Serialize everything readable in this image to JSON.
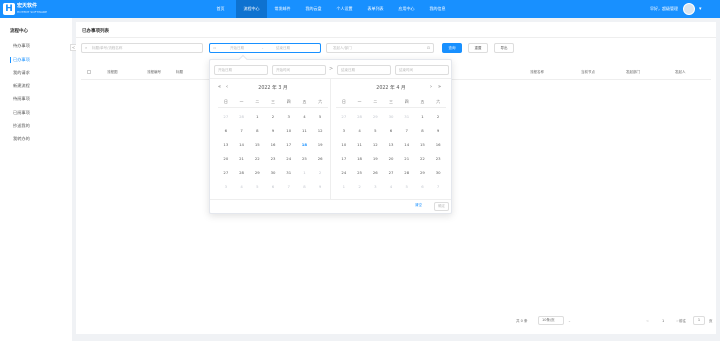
{
  "brand": {
    "name": "宏天软件",
    "sub": "HOTENT SOFTWARE",
    "logo_letter": "H"
  },
  "nav": [
    {
      "label": "首页"
    },
    {
      "label": "流程中心",
      "active": true
    },
    {
      "label": "常发邮件"
    },
    {
      "label": "我的云盘"
    },
    {
      "label": "个人设置"
    },
    {
      "label": "表单列表"
    },
    {
      "label": "应用中心"
    },
    {
      "label": "我的信息"
    }
  ],
  "user": {
    "greeting": "早好，超级管理"
  },
  "sidebar": {
    "title": "流程中心",
    "items": [
      {
        "label": "待办事项"
      },
      {
        "label": "已办事项",
        "active": true
      },
      {
        "label": "我的请求"
      },
      {
        "label": "新建流程"
      },
      {
        "label": "待阅事项"
      },
      {
        "label": "已阅事项"
      },
      {
        "label": "抄送我的"
      },
      {
        "label": "我转办的"
      }
    ],
    "collapse": "<"
  },
  "main": {
    "title": "已办事项列表",
    "search_placeholder": "标题/单号/流程名称",
    "date_start": "开始日期",
    "date_sep": "-",
    "date_end": "结束日期",
    "person_placeholder": "发起人/部门",
    "btn_search": "查询",
    "btn_reset": "重置",
    "btn_export": "导出",
    "columns": [
      "流程图",
      "流程编号",
      "标题",
      "流程名称",
      "当前节点",
      "发起部门",
      "发起人"
    ]
  },
  "picker": {
    "start_date_ph": "开始日期",
    "start_time_ph": "开始时间",
    "end_date_ph": "结束日期",
    "end_time_ph": "结束时间",
    "sep": ">",
    "weekdays": [
      "日",
      "一",
      "二",
      "三",
      "四",
      "五",
      "六"
    ],
    "left": {
      "title": "2022 年 3 月",
      "days": [
        {
          "d": "27",
          "o": true
        },
        {
          "d": "28",
          "o": true
        },
        {
          "d": "1"
        },
        {
          "d": "2"
        },
        {
          "d": "3"
        },
        {
          "d": "4"
        },
        {
          "d": "5"
        },
        {
          "d": "6"
        },
        {
          "d": "7"
        },
        {
          "d": "8"
        },
        {
          "d": "9"
        },
        {
          "d": "10"
        },
        {
          "d": "11"
        },
        {
          "d": "12"
        },
        {
          "d": "13"
        },
        {
          "d": "14"
        },
        {
          "d": "15"
        },
        {
          "d": "16"
        },
        {
          "d": "17"
        },
        {
          "d": "18",
          "t": true
        },
        {
          "d": "19"
        },
        {
          "d": "20"
        },
        {
          "d": "21"
        },
        {
          "d": "22"
        },
        {
          "d": "23"
        },
        {
          "d": "24"
        },
        {
          "d": "25"
        },
        {
          "d": "26"
        },
        {
          "d": "27"
        },
        {
          "d": "28"
        },
        {
          "d": "29"
        },
        {
          "d": "30"
        },
        {
          "d": "31"
        },
        {
          "d": "1",
          "o": true
        },
        {
          "d": "2",
          "o": true
        },
        {
          "d": "3",
          "o": true
        },
        {
          "d": "4",
          "o": true
        },
        {
          "d": "5",
          "o": true
        },
        {
          "d": "6",
          "o": true
        },
        {
          "d": "7",
          "o": true
        },
        {
          "d": "8",
          "o": true
        },
        {
          "d": "9",
          "o": true
        }
      ]
    },
    "right": {
      "title": "2022 年 4 月",
      "days": [
        {
          "d": "27",
          "o": true
        },
        {
          "d": "28",
          "o": true
        },
        {
          "d": "29",
          "o": true
        },
        {
          "d": "30",
          "o": true
        },
        {
          "d": "31",
          "o": true
        },
        {
          "d": "1"
        },
        {
          "d": "2"
        },
        {
          "d": "3"
        },
        {
          "d": "4"
        },
        {
          "d": "5"
        },
        {
          "d": "6"
        },
        {
          "d": "7"
        },
        {
          "d": "8"
        },
        {
          "d": "9"
        },
        {
          "d": "10"
        },
        {
          "d": "11"
        },
        {
          "d": "12"
        },
        {
          "d": "13"
        },
        {
          "d": "14"
        },
        {
          "d": "15"
        },
        {
          "d": "16"
        },
        {
          "d": "17"
        },
        {
          "d": "18"
        },
        {
          "d": "19"
        },
        {
          "d": "20"
        },
        {
          "d": "21"
        },
        {
          "d": "22"
        },
        {
          "d": "23"
        },
        {
          "d": "24"
        },
        {
          "d": "25"
        },
        {
          "d": "26"
        },
        {
          "d": "27"
        },
        {
          "d": "28"
        },
        {
          "d": "29"
        },
        {
          "d": "30"
        },
        {
          "d": "1",
          "o": true
        },
        {
          "d": "2",
          "o": true
        },
        {
          "d": "3",
          "o": true
        },
        {
          "d": "4",
          "o": true
        },
        {
          "d": "5",
          "o": true
        },
        {
          "d": "6",
          "o": true
        },
        {
          "d": "7",
          "o": true
        }
      ]
    },
    "clear": "清空",
    "ok": "确定"
  },
  "pagination": {
    "total": "共 0 条",
    "page_size": "10条/页",
    "prev": "<",
    "current": "1",
    "next": ">",
    "goto_label": "前往",
    "goto_value": "1",
    "page_unit": "页"
  },
  "colors": {
    "accent": "#1890ff"
  }
}
